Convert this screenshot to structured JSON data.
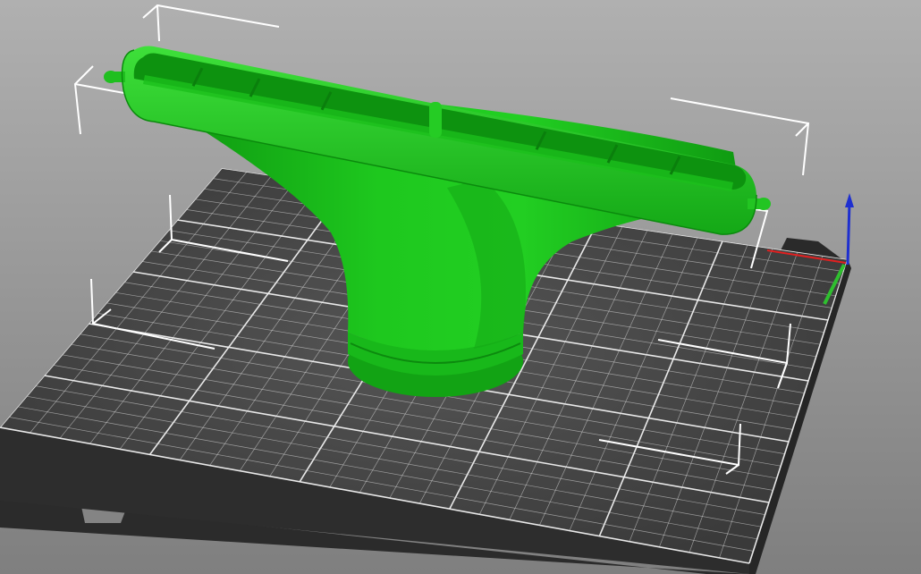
{
  "viewport": {
    "view": "3D",
    "background_top": "#b0b0b0",
    "background_bottom": "#7f7f7f"
  },
  "bed": {
    "plate_color": "#3f3f3f",
    "plate_edge_color": "#2b2b2b",
    "grid_color": "#d8d8d8",
    "grid_major_color": "#f2f2f2"
  },
  "model": {
    "object": "vacuum-nozzle",
    "color": "#19c21a",
    "shadow_color": "#0e8f10",
    "highlight_color": "#45e43e",
    "selected": true,
    "bounding_box_color": "#ffffff"
  },
  "axes": {
    "x_color": "#e02020",
    "y_color": "#2fbf2f",
    "z_color": "#1e2fd0"
  }
}
